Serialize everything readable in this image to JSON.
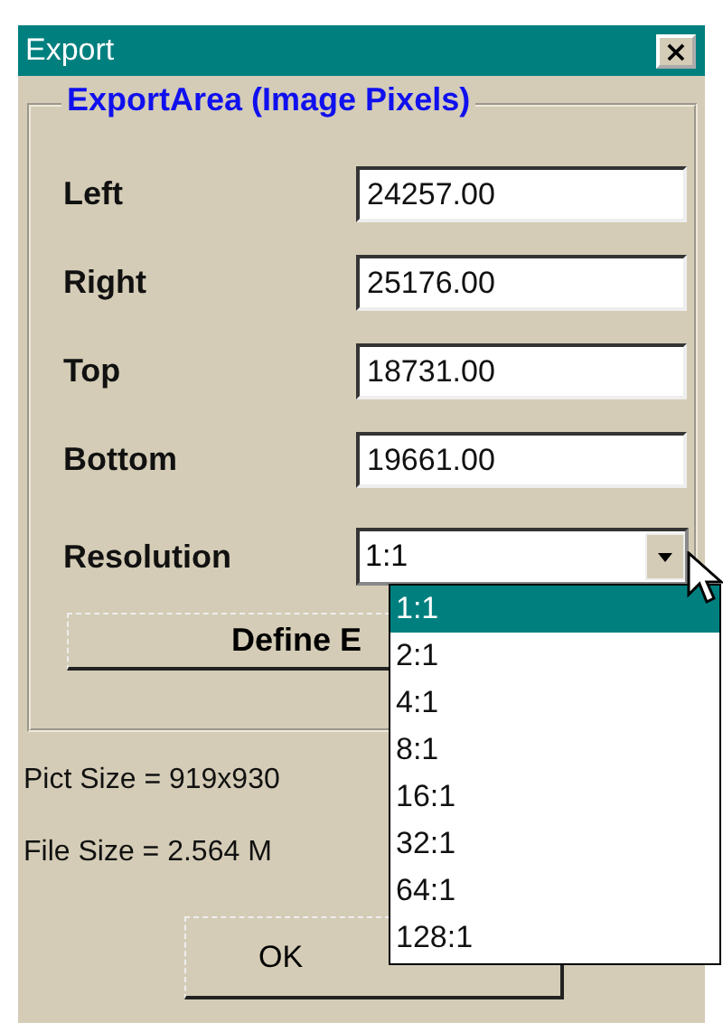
{
  "window": {
    "title": "Export",
    "close": "×"
  },
  "group": {
    "legend": "ExportArea (Image Pixels)"
  },
  "fields": [
    {
      "label": "Left",
      "value": "24257.00"
    },
    {
      "label": "Right",
      "value": "25176.00"
    },
    {
      "label": "Top",
      "value": "18731.00"
    },
    {
      "label": "Bottom",
      "value": "19661.00"
    }
  ],
  "resolution": {
    "label": "Resolution",
    "value": "1:1",
    "expanded": true,
    "options": [
      {
        "label": "1:1",
        "selected": true
      },
      {
        "label": "2:1",
        "selected": false
      },
      {
        "label": "4:1",
        "selected": false
      },
      {
        "label": "8:1",
        "selected": false
      },
      {
        "label": "16:1",
        "selected": false
      },
      {
        "label": "32:1",
        "selected": false
      },
      {
        "label": "64:1",
        "selected": false
      },
      {
        "label": "128:1",
        "selected": false
      }
    ]
  },
  "define_button": "Define E",
  "info": [
    "Pict Size = 919x930",
    "File Size = 2.564 M"
  ],
  "ok_button": "OK"
}
